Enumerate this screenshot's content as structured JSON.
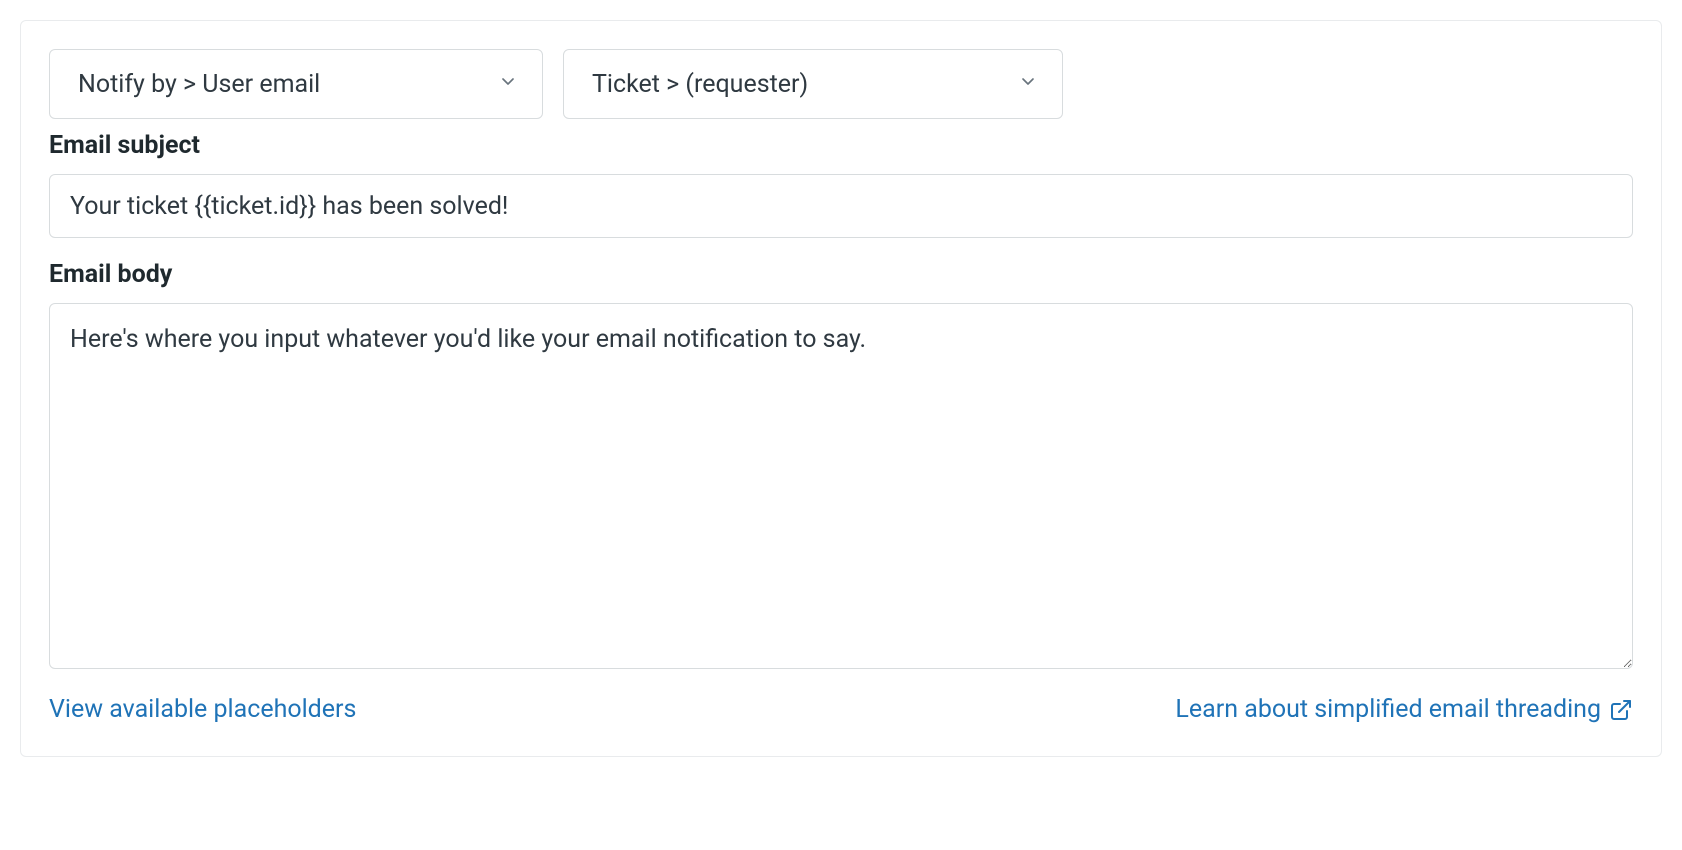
{
  "selects": {
    "action": "Notify by > User email",
    "target": "Ticket > (requester)"
  },
  "labels": {
    "email_subject": "Email subject",
    "email_body": "Email body"
  },
  "fields": {
    "email_subject_value": "Your ticket {{ticket.id}} has been solved!",
    "email_body_value": "Here's where you input whatever you'd like your email notification to say."
  },
  "links": {
    "view_placeholders": "View available placeholders",
    "learn_threading": "Learn about simplified email threading"
  }
}
